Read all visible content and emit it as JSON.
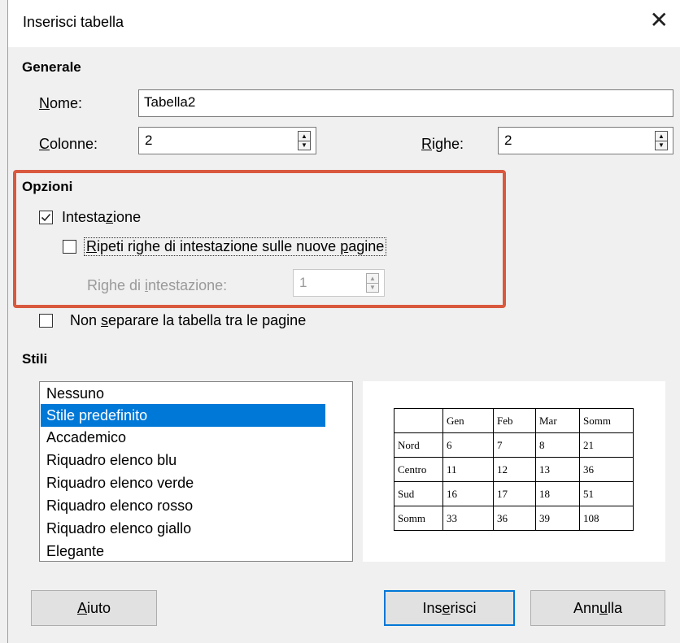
{
  "window": {
    "title": "Inserisci tabella",
    "close_glyph": "✕"
  },
  "general": {
    "heading": "Generale",
    "name_label_u": "N",
    "name_label_rest": "ome:",
    "name_value": "Tabella2",
    "columns_label_u": "C",
    "columns_label_rest": "olonne:",
    "columns_value": "2",
    "rows_label_u": "R",
    "rows_label_rest": "ighe:",
    "rows_value": "2"
  },
  "options": {
    "heading": "Opzioni",
    "header_label_a": "Intesta",
    "header_label_u": "z",
    "header_label_b": "ione",
    "header_checked": true,
    "repeat_label_u": "R",
    "repeat_label_b": "ipeti righe di intestazione sulle nuove ",
    "repeat_label_u2": "p",
    "repeat_label_c": "agine",
    "repeat_checked": false,
    "header_rows_label_a": "Righe di ",
    "header_rows_label_u": "i",
    "header_rows_label_b": "ntestazione:",
    "header_rows_value": "1",
    "nosplit_label_a": "Non ",
    "nosplit_label_u": "s",
    "nosplit_label_b": "eparare la tabella tra le pagine",
    "nosplit_checked": false
  },
  "styles": {
    "heading": "Stili",
    "items": [
      "Nessuno",
      "Stile predefinito",
      "Accademico",
      "Riquadro elenco blu",
      "Riquadro elenco verde",
      "Riquadro elenco rosso",
      "Riquadro elenco giallo",
      "Elegante"
    ],
    "selected": "Stile predefinito"
  },
  "preview": {
    "rows": [
      [
        "",
        "Gen",
        "Feb",
        "Mar",
        "Somm"
      ],
      [
        "Nord",
        "6",
        "7",
        "8",
        "21"
      ],
      [
        "Centro",
        "11",
        "12",
        "13",
        "36"
      ],
      [
        "Sud",
        "16",
        "17",
        "18",
        "51"
      ],
      [
        "Somm",
        "33",
        "36",
        "39",
        "108"
      ]
    ]
  },
  "buttons": {
    "help_u": "A",
    "help_rest": "iuto",
    "insert_a": "Ins",
    "insert_u": "e",
    "insert_b": "risci",
    "cancel_a": "Ann",
    "cancel_u": "u",
    "cancel_b": "lla"
  },
  "colors": {
    "highlight": "#d9593f",
    "selection": "#0078d7"
  }
}
